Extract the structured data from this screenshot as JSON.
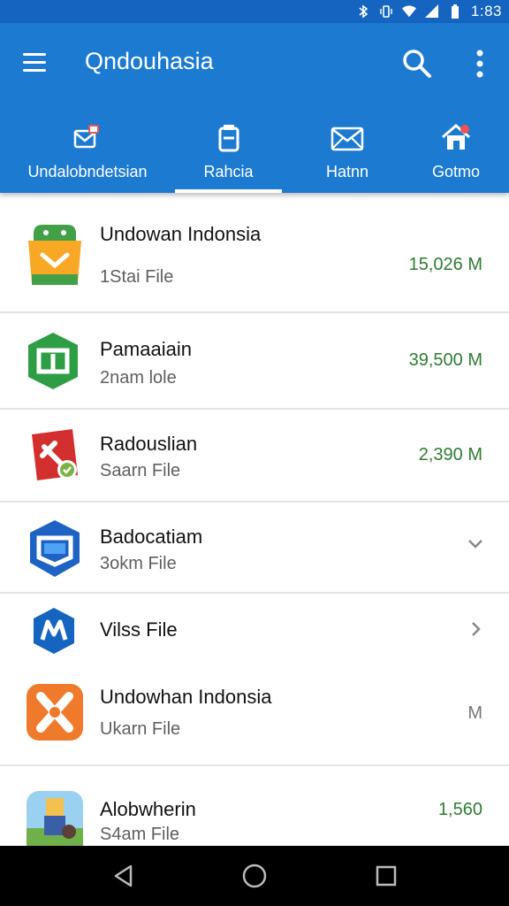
{
  "status_bar": {
    "time": "1:83",
    "icons": [
      "bluetooth-icon",
      "vibrate-icon",
      "wifi-icon",
      "signal-icon",
      "battery-icon"
    ]
  },
  "app_bar": {
    "title": "Qndouhasia",
    "color": "#1c7ad0",
    "icons": {
      "menu": "menu-icon",
      "search": "search-icon",
      "more": "more-vert-icon"
    }
  },
  "tabs": [
    {
      "label": "Undalobndetsian",
      "icon": "mail-badge-icon",
      "selected": false
    },
    {
      "label": "Rahcia",
      "icon": "document-icon",
      "selected": true
    },
    {
      "label": "Hatnn",
      "icon": "envelope-icon",
      "selected": false
    },
    {
      "label": "Gotmo",
      "icon": "home-icon",
      "selected": false
    }
  ],
  "files": [
    {
      "title": "Undowan Indonsia",
      "subtitle": "1Stai File",
      "size": "15,026 M",
      "icon": "android-download-icon"
    },
    {
      "title": "Pamaaiain",
      "subtitle": "2nam lole",
      "size": "39,500 M",
      "icon": "green-square-app-icon"
    },
    {
      "title": "Radouslian",
      "subtitle": "Saarn File",
      "size": "2,390 M",
      "icon": "red-tools-app-icon"
    },
    {
      "title": "Badocatiam",
      "subtitle": "3okm File",
      "size": "",
      "icon": "blue-hexagon-app-icon",
      "trailing": "chevron-down-icon"
    },
    {
      "title": "Vilss File",
      "subtitle": "",
      "size": "",
      "icon": "m-logo-app-icon",
      "trailing": "chevron-right-icon"
    },
    {
      "title": "Undowhan Indonsia",
      "subtitle": "Ukarn File",
      "size": "M",
      "icon": "orange-puzzle-app-icon"
    },
    {
      "title": "Alobwherin",
      "subtitle": "S4am File",
      "size": "1,560",
      "icon": "game-character-app-icon"
    }
  ],
  "colors": {
    "primary": "#1c7ad0",
    "status_bar": "#1565c0",
    "size_text": "#2e7d32",
    "nav_bar": "#000000"
  },
  "nav_bar": {
    "icons": [
      "back-icon",
      "home-circle-icon",
      "recents-icon"
    ]
  }
}
